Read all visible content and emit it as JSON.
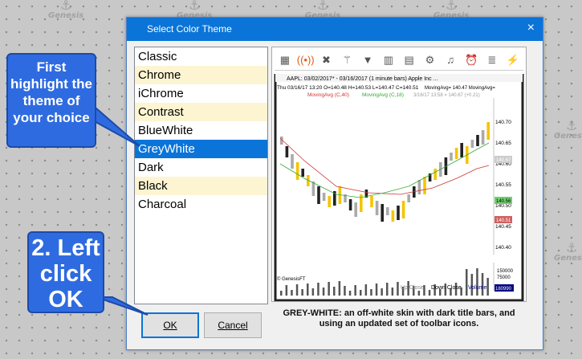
{
  "watermark": {
    "text": "Genesis",
    "icon": "anchor-icon"
  },
  "dialog": {
    "title": "Select Color Theme",
    "close_icon": "×",
    "themes": [
      {
        "label": "Classic",
        "alt": false
      },
      {
        "label": "Chrome",
        "alt": true
      },
      {
        "label": "iChrome",
        "alt": false
      },
      {
        "label": "Contrast",
        "alt": true
      },
      {
        "label": "BlueWhite",
        "alt": false
      },
      {
        "label": "GreyWhite",
        "alt": false,
        "selected": true
      },
      {
        "label": "Dark",
        "alt": false
      },
      {
        "label": "Black",
        "alt": true
      },
      {
        "label": "Charcoal",
        "alt": false
      }
    ],
    "preview": {
      "toolbar_icons": [
        "chart-icon",
        "wifi-icon",
        "tools-icon",
        "wand-icon",
        "filter-icon",
        "notebook-icon",
        "news-icon",
        "gear-icon",
        "bell-ring-icon",
        "clock-icon",
        "list-icon",
        "bolt-icon"
      ],
      "header": "AAPL:  03/02/2017* - 03/16/2017  (1 minute bars)   Apple Inc  ...",
      "header2": "Thu  03/16/17 13:20  O=140.48  H=140.53  L=140.47  C=140.51",
      "ma1": "MovingAvg (C,40)",
      "ma2": "MovingAvg (C,18)",
      "ma_vals": "3/16/17 13:58 = 140.67 (+0.21)",
      "ma_right": "MovingAvg= 140.47  MovingAvg=",
      "y_labels": [
        "140.70",
        "140.65",
        "140.60",
        "140.55",
        "140.50",
        "140.45",
        "140.40"
      ],
      "last_price": "140.67",
      "badge_green": "140.56",
      "badge_red": "140.51",
      "copyright": "© GenesisFT",
      "legend": [
        "Up Close",
        "Down Close",
        "Volume"
      ],
      "vol_labels": [
        "180990",
        "150000",
        "75000",
        "0"
      ]
    },
    "description": "GREY-WHITE: an off-white skin with dark title bars, and using an updated set of toolbar icons.",
    "ok_label": "OK",
    "cancel_label": "Cancel"
  },
  "callout1": "First highlight the theme of your choice",
  "callout2": "2. Left click OK",
  "colors": {
    "accent": "#0a74d8",
    "callout": "#2f6be0",
    "up": "#f5c400",
    "down": "#222222",
    "ma1": "#cc3333",
    "ma2": "#33aa33"
  }
}
